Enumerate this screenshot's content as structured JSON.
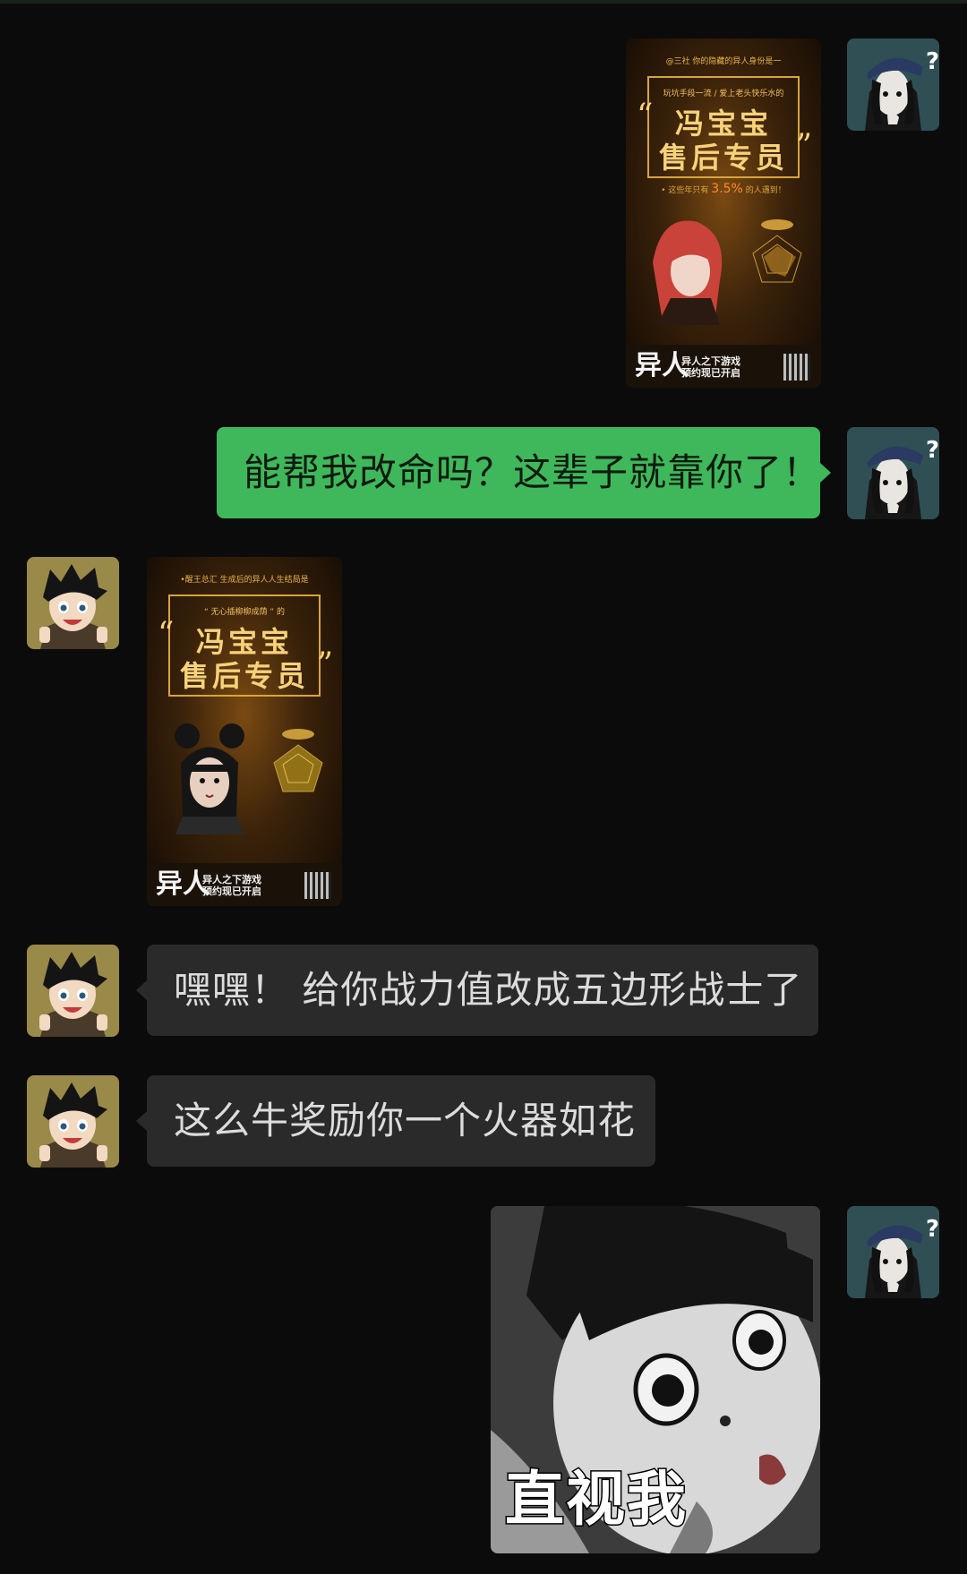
{
  "messages": [
    {
      "side": "right",
      "type": "image",
      "content": "poster-1"
    },
    {
      "side": "right",
      "type": "text",
      "text": "能帮我改命吗？这辈子就靠你了！"
    },
    {
      "side": "left",
      "type": "image",
      "content": "poster-2"
    },
    {
      "side": "left",
      "type": "text",
      "text": "嘿嘿！ 给你战力值改成五边形战士了"
    },
    {
      "side": "left",
      "type": "text",
      "text": "这么牛奖励你一个火器如花"
    },
    {
      "side": "right",
      "type": "image",
      "content": "meme"
    }
  ],
  "poster1": {
    "top_text": "@三社  你的隐藏的异人身份是一",
    "sub": "玩坑手段一流 / 爱上老头快乐水的",
    "title_line1": "冯宝宝",
    "title_line2": "售后专员",
    "pct_prefix": "• 这些年只有",
    "pct_value": "3.5%",
    "pct_suffix": "的人遇到！",
    "logo": "异人",
    "footer_line1": "异人之下游戏",
    "footer_line2": "预约现已开启"
  },
  "poster2": {
    "top_text": "•醒王总汇 生成后的异人人生结局是",
    "sub": "“ 无心插柳柳成荫 ” 的",
    "title_line1": "冯宝宝",
    "title_line2": "售后专员",
    "logo": "异人",
    "footer_line1": "异人之下游戏",
    "footer_line2": "预约现已开启"
  },
  "meme": {
    "caption": "直视我"
  },
  "colors": {
    "background": "#0b0b0b",
    "green_bubble": "#3eb85a",
    "dark_bubble": "#2a2a2a",
    "poster_gold": "#f6d27a"
  }
}
